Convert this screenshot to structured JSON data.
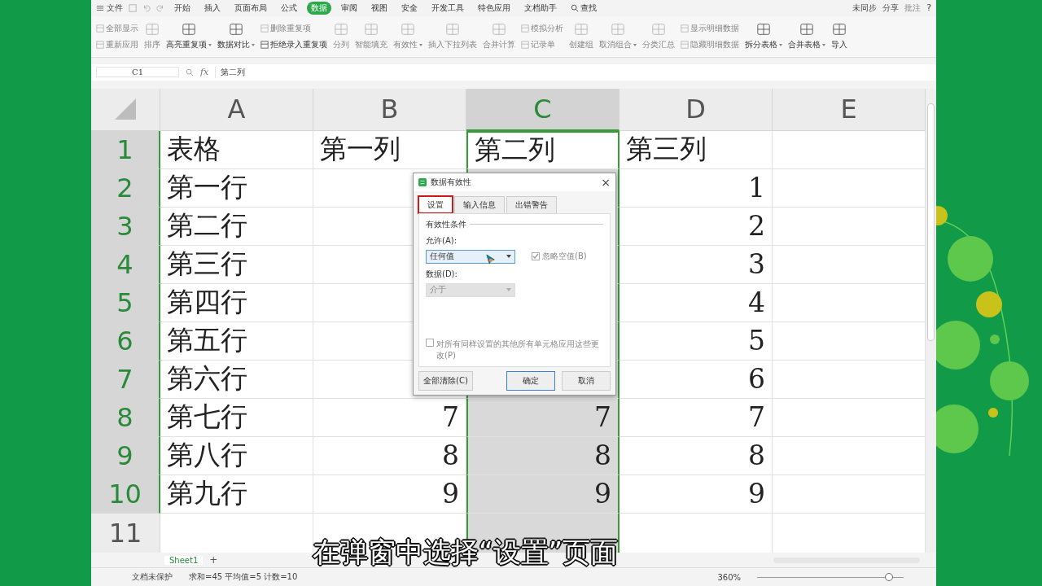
{
  "menu": {
    "file": "文件",
    "tabs": [
      {
        "label": "开始",
        "selected": false
      },
      {
        "label": "插入",
        "selected": false
      },
      {
        "label": "页面布局",
        "selected": false
      },
      {
        "label": "公式",
        "selected": false
      },
      {
        "label": "数据",
        "selected": true
      },
      {
        "label": "审阅",
        "selected": false
      },
      {
        "label": "视图",
        "selected": false
      },
      {
        "label": "安全",
        "selected": false
      },
      {
        "label": "开发工具",
        "selected": false
      },
      {
        "label": "特色应用",
        "selected": false
      },
      {
        "label": "文档助手",
        "selected": false
      }
    ],
    "search": "查找",
    "sync": "未同步",
    "share": "分享",
    "comment": "批注",
    "help": "?"
  },
  "ribbon": [
    {
      "kind": "pair",
      "items": [
        {
          "label": "全部显示",
          "disabled": true
        },
        {
          "label": "重新应用",
          "disabled": true
        }
      ]
    },
    {
      "kind": "large",
      "label": "排序",
      "disabled": true,
      "caret": false
    },
    {
      "kind": "large",
      "label": "高亮重复项",
      "disabled": false,
      "caret": true
    },
    {
      "kind": "large",
      "label": "数据对比",
      "disabled": false,
      "caret": true
    },
    {
      "kind": "pair",
      "items": [
        {
          "label": "删除重复项",
          "disabled": true
        },
        {
          "label": "拒绝录入重复项",
          "disabled": false
        }
      ]
    },
    {
      "kind": "large",
      "label": "分列",
      "disabled": true,
      "caret": false
    },
    {
      "kind": "large",
      "label": "智能填充",
      "disabled": true,
      "caret": false
    },
    {
      "kind": "large",
      "label": "有效性",
      "disabled": true,
      "caret": true
    },
    {
      "kind": "large",
      "label": "插入下拉列表",
      "disabled": true,
      "caret": false
    },
    {
      "kind": "large",
      "label": "合并计算",
      "disabled": true,
      "caret": false
    },
    {
      "kind": "pair",
      "items": [
        {
          "label": "模拟分析",
          "disabled": true
        },
        {
          "label": "记录单",
          "disabled": true
        }
      ]
    },
    {
      "kind": "large",
      "label": "创建组",
      "disabled": true,
      "caret": false
    },
    {
      "kind": "large",
      "label": "取消组合",
      "disabled": true,
      "caret": true
    },
    {
      "kind": "large",
      "label": "分类汇总",
      "disabled": true,
      "caret": false
    },
    {
      "kind": "pair",
      "items": [
        {
          "label": "显示明细数据",
          "disabled": true
        },
        {
          "label": "隐藏明细数据",
          "disabled": true
        }
      ]
    },
    {
      "kind": "large",
      "label": "拆分表格",
      "disabled": false,
      "caret": true
    },
    {
      "kind": "large",
      "label": "合并表格",
      "disabled": false,
      "caret": true
    },
    {
      "kind": "large",
      "label": "导入",
      "disabled": false,
      "caret": false
    }
  ],
  "formula_bar": {
    "name_box": "C1",
    "fx": "fx",
    "value": "第二列"
  },
  "columns": [
    {
      "label": "A",
      "selected": false
    },
    {
      "label": "B",
      "selected": false
    },
    {
      "label": "C",
      "selected": true
    },
    {
      "label": "D",
      "selected": false
    },
    {
      "label": "E",
      "selected": false
    }
  ],
  "rows": [
    {
      "header": "1",
      "kind": "labels",
      "selected": true,
      "has_active_cell": true,
      "cells": [
        "表格",
        "第一列",
        "第二列",
        "第三列",
        null
      ]
    },
    {
      "header": "2",
      "kind": "values",
      "selected": true,
      "has_active_cell": false,
      "cells": [
        "第一行",
        null,
        null,
        "1",
        null
      ]
    },
    {
      "header": "3",
      "kind": "values",
      "selected": true,
      "has_active_cell": false,
      "cells": [
        "第二行",
        null,
        null,
        "2",
        null
      ]
    },
    {
      "header": "4",
      "kind": "values",
      "selected": true,
      "has_active_cell": false,
      "cells": [
        "第三行",
        null,
        null,
        "3",
        null
      ]
    },
    {
      "header": "5",
      "kind": "values",
      "selected": true,
      "has_active_cell": false,
      "cells": [
        "第四行",
        null,
        null,
        "4",
        null
      ]
    },
    {
      "header": "6",
      "kind": "values",
      "selected": true,
      "has_active_cell": false,
      "cells": [
        "第五行",
        null,
        null,
        "5",
        null
      ]
    },
    {
      "header": "7",
      "kind": "values",
      "selected": true,
      "has_active_cell": false,
      "cells": [
        "第六行",
        null,
        null,
        "6",
        null
      ]
    },
    {
      "header": "8",
      "kind": "values",
      "selected": true,
      "has_active_cell": false,
      "cells": [
        "第七行",
        "7",
        "7",
        "7",
        null
      ]
    },
    {
      "header": "9",
      "kind": "values",
      "selected": true,
      "has_active_cell": false,
      "cells": [
        "第八行",
        "8",
        "8",
        "8",
        null
      ]
    },
    {
      "header": "10",
      "kind": "values",
      "selected": true,
      "has_active_cell": false,
      "cells": [
        "第九行",
        "9",
        "9",
        "9",
        null
      ]
    },
    {
      "header": "11",
      "kind": "values",
      "selected": false,
      "has_active_cell": false,
      "cells": [
        null,
        null,
        null,
        null,
        null
      ]
    }
  ],
  "sheet_tabs": [
    {
      "label": "Sheet1",
      "selected": true
    }
  ],
  "add_sheet": "+",
  "status_bar": {
    "protection": "文档未保护",
    "stats": "求和=45  平均值=5  计数=10",
    "zoom": "360%",
    "zoom_slider": {
      "level": 0.9
    }
  },
  "dialog": {
    "title": "数据有效性",
    "close": "×",
    "tabs": [
      {
        "label": "设置",
        "selected": true
      },
      {
        "label": "输入信息",
        "selected": false
      },
      {
        "label": "出错警告",
        "selected": false
      }
    ],
    "group": "有效性条件",
    "allow_label": "允许(A):",
    "allow_value": "任何值",
    "ignore_blank": {
      "label": "忽略空值(B)",
      "checked": true,
      "disabled": true
    },
    "data_label": "数据(D):",
    "data_value": "介于",
    "data_disabled": true,
    "apply_all": {
      "label": "对所有同样设置的其他所有单元格应用这些更改(P)",
      "checked": false,
      "disabled": true
    },
    "buttons": [
      {
        "label": "全部清除(C)",
        "kind": "left"
      },
      {
        "label": "确定",
        "kind": "default"
      },
      {
        "label": "取消",
        "kind": "plain"
      }
    ]
  },
  "subtitle": "在弹窗中选择“设置”页面"
}
